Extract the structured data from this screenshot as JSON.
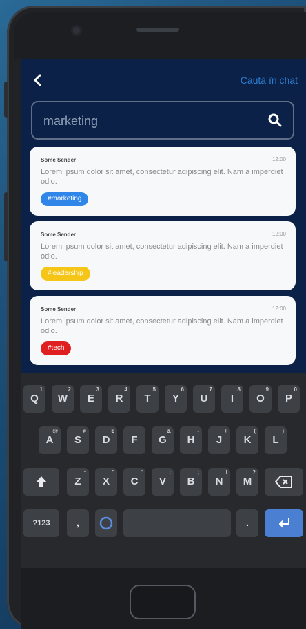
{
  "appbar": {
    "back_icon": "chevron-left-icon",
    "link_label": "Caută în chat"
  },
  "search": {
    "value": "marketing",
    "icon": "search-icon"
  },
  "messages": [
    {
      "sender": "Some Sender",
      "time": "12:00",
      "text": "Lorem ipsum dolor sit amet, consectetur adipiscing elit. Nam a imperdiet odio.",
      "tag": "#marketing",
      "tag_color": "#2f86e8"
    },
    {
      "sender": "Some Sender",
      "time": "12:00",
      "text": "Lorem ipsum dolor sit amet, consectetur adipiscing elit. Nam a imperdiet odio.",
      "tag": "#leadership",
      "tag_color": "#f5c518"
    },
    {
      "sender": "Some Sender",
      "time": "12:00",
      "text": "Lorem ipsum dolor sit amet, consectetur adipiscing elit. Nam a imperdiet odio.",
      "tag": "#tech",
      "tag_color": "#e02020"
    }
  ],
  "keyboard": {
    "row1": [
      {
        "k": "Q",
        "n": "1"
      },
      {
        "k": "W",
        "n": "2"
      },
      {
        "k": "E",
        "n": "3"
      },
      {
        "k": "R",
        "n": "4"
      },
      {
        "k": "T",
        "n": "5"
      },
      {
        "k": "Y",
        "n": "6"
      },
      {
        "k": "U",
        "n": "7"
      },
      {
        "k": "I",
        "n": "8"
      },
      {
        "k": "O",
        "n": "9"
      },
      {
        "k": "P",
        "n": "0"
      }
    ],
    "row2": [
      {
        "k": "A",
        "n": "@"
      },
      {
        "k": "S",
        "n": "#"
      },
      {
        "k": "D",
        "n": "$"
      },
      {
        "k": "F",
        "n": "_"
      },
      {
        "k": "G",
        "n": "&"
      },
      {
        "k": "H",
        "n": "-"
      },
      {
        "k": "J",
        "n": "+"
      },
      {
        "k": "K",
        "n": "("
      },
      {
        "k": "L",
        "n": ")"
      }
    ],
    "row3": [
      {
        "k": "Z",
        "n": "*"
      },
      {
        "k": "X",
        "n": "\""
      },
      {
        "k": "C",
        "n": "'"
      },
      {
        "k": "V",
        "n": ":"
      },
      {
        "k": "B",
        "n": ";"
      },
      {
        "k": "N",
        "n": "!"
      },
      {
        "k": "M",
        "n": "?"
      }
    ],
    "shift_icon": "shift-icon",
    "backspace_icon": "backspace-icon",
    "numbers_label": "?123",
    "comma_label": ",",
    "period_label": ".",
    "emoji_icon": "emoji-icon",
    "enter_icon": "enter-icon"
  }
}
